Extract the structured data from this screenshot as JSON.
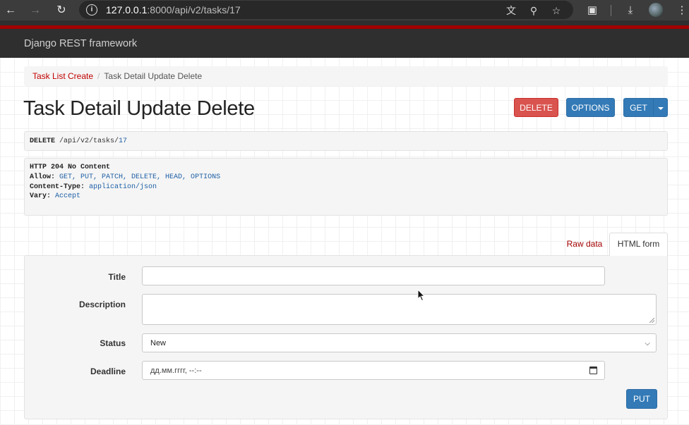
{
  "browser": {
    "url_host": "127.0.0.1",
    "url_rest": ":8000/api/v2/tasks/17",
    "back_icon": "arrow-left-icon",
    "forward_icon": "arrow-right-icon",
    "reload_icon": "reload-icon"
  },
  "navbar": {
    "brand": "Django REST framework"
  },
  "breadcrumb": {
    "items": [
      {
        "label": "Task List Create"
      },
      {
        "label": "Task Detail Update Delete"
      }
    ],
    "divider": "/"
  },
  "page": {
    "title": "Task Detail Update Delete"
  },
  "actions": {
    "delete_label": "DELETE",
    "options_label": "OPTIONS",
    "get_label": "GET"
  },
  "request": {
    "method": "DELETE",
    "path_prefix": "/api/v2/tasks/",
    "path_id": "17"
  },
  "response": {
    "status_line": "HTTP 204 No Content",
    "headers": [
      {
        "name": "Allow:",
        "value": "GET, PUT, PATCH, DELETE, HEAD, OPTIONS"
      },
      {
        "name": "Content-Type:",
        "value": "application/json"
      },
      {
        "name": "Vary:",
        "value": "Accept"
      }
    ]
  },
  "tabs": {
    "raw_label": "Raw data",
    "html_label": "HTML form"
  },
  "form": {
    "title_label": "Title",
    "title_value": "",
    "description_label": "Description",
    "description_value": "",
    "status_label": "Status",
    "status_value": "New",
    "deadline_label": "Deadline",
    "deadline_placeholder": "дд.мм.гггг, --:--",
    "submit_label": "PUT"
  },
  "colors": {
    "django_red": "#a30000",
    "navbar_bg": "#2f2f2f",
    "primary_blue": "#337ab7",
    "danger_red": "#d9534f"
  }
}
